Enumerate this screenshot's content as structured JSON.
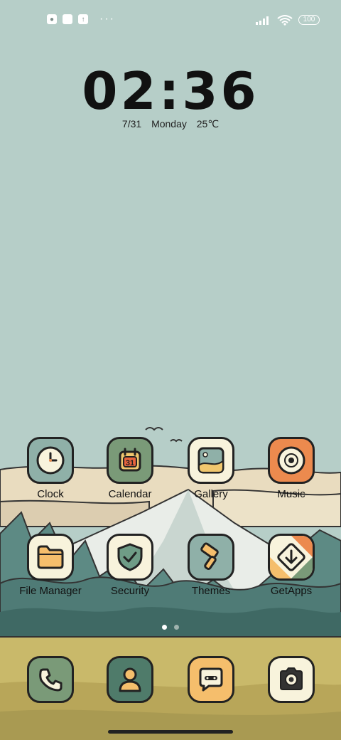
{
  "status_bar": {
    "left_icons": [
      "app-notification-icon",
      "square-notification-icon",
      "upload-notification-icon"
    ],
    "more": "···",
    "right_icons": [
      "signal-icon",
      "wifi-icon"
    ],
    "battery": "100"
  },
  "clock": {
    "time": "02:36",
    "date": "7/31",
    "weekday": "Monday",
    "temperature": "25℃"
  },
  "apps_row1": [
    {
      "label": "Clock",
      "icon": "clock-icon"
    },
    {
      "label": "Calendar",
      "icon": "calendar-icon",
      "badge": "31"
    },
    {
      "label": "Gallery",
      "icon": "gallery-icon"
    },
    {
      "label": "Music",
      "icon": "music-icon"
    }
  ],
  "apps_row2": [
    {
      "label": "File Manager",
      "icon": "folder-icon"
    },
    {
      "label": "Security",
      "icon": "shield-icon"
    },
    {
      "label": "Themes",
      "icon": "paint-roller-icon"
    },
    {
      "label": "GetApps",
      "icon": "download-icon"
    }
  ],
  "dock": [
    {
      "icon": "phone-icon"
    },
    {
      "icon": "contacts-icon"
    },
    {
      "icon": "messages-icon"
    },
    {
      "icon": "camera-icon"
    }
  ],
  "page_indicator": {
    "count": 2,
    "active": 0
  },
  "colors": {
    "sky": "#b6cec8",
    "mountain": "#e9ede8",
    "forest": "#5d8a84",
    "field": "#c9b96a",
    "icon_green": "#7a9a78",
    "icon_cream": "#f8f3dc",
    "icon_orange": "#ec8a4e",
    "icon_sage": "#8fb0a8"
  }
}
